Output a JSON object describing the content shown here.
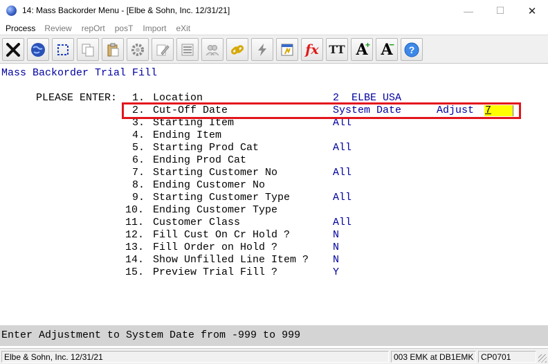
{
  "window": {
    "title": "14: Mass Backorder Menu - [Elbe & Sohn, Inc. 12/31/21]",
    "minimize": "—",
    "maximize": "☐",
    "close": "✕"
  },
  "menu": {
    "items": [
      "Process",
      "Review",
      "repOrt",
      "posT",
      "Import",
      "eXit"
    ]
  },
  "toolbar": {
    "buttons": [
      "close-x-icon",
      "globe-icon",
      "select-region-icon",
      "copy-icon",
      "paste-icon",
      "settings-gear-icon",
      "edit-pencil-icon",
      "list-icon",
      "users-icon",
      "link-icon",
      "lightning-icon",
      "calculator-icon",
      "function-icon",
      "font-size-icon",
      "increase-font-icon",
      "decrease-font-icon",
      "help-icon"
    ],
    "fx_label": "fx",
    "tt_label": "TT",
    "a_plus_label": "A",
    "a_minus_label": "A"
  },
  "screen": {
    "heading": "Mass Backorder Trial Fill",
    "prompt_label": "PLEASE ENTER:",
    "fields": [
      {
        "num": "1.",
        "label": "Location",
        "value": "2  ELBE USA"
      },
      {
        "num": "2.",
        "label": "Cut-Off Date",
        "value": "System Date"
      },
      {
        "num": "3.",
        "label": "Starting Item",
        "value": "All"
      },
      {
        "num": "4.",
        "label": "Ending Item",
        "value": ""
      },
      {
        "num": "5.",
        "label": "Starting Prod Cat",
        "value": "All"
      },
      {
        "num": "6.",
        "label": "Ending Prod Cat",
        "value": ""
      },
      {
        "num": "7.",
        "label": "Starting Customer No",
        "value": "All"
      },
      {
        "num": "8.",
        "label": "Ending Customer No",
        "value": ""
      },
      {
        "num": "9.",
        "label": "Starting Customer Type",
        "value": "All"
      },
      {
        "num": "10.",
        "label": "Ending Customer Type",
        "value": ""
      },
      {
        "num": "11.",
        "label": "Customer Class",
        "value": "All"
      },
      {
        "num": "12.",
        "label": "Fill Cust On Cr Hold ?",
        "value": "N"
      },
      {
        "num": "13.",
        "label": "Fill Order on Hold ?",
        "value": "N"
      },
      {
        "num": "14.",
        "label": "Show Unfilled Line Item ?",
        "value": "N"
      },
      {
        "num": "15.",
        "label": "Preview Trial Fill ?",
        "value": "Y"
      }
    ],
    "adjust_label": "Adjust",
    "adjust_value": "7"
  },
  "help": {
    "text": "Enter Adjustment to System Date from -999 to 999"
  },
  "status": {
    "company": "Elbe & Sohn, Inc. 12/31/21",
    "session": "003 EMK at DB1EMK",
    "program": "CP0701"
  },
  "colors": {
    "highlight_border": "#e3141c",
    "input_background": "#ffff00",
    "screen_text_blue": "#0000a0"
  }
}
